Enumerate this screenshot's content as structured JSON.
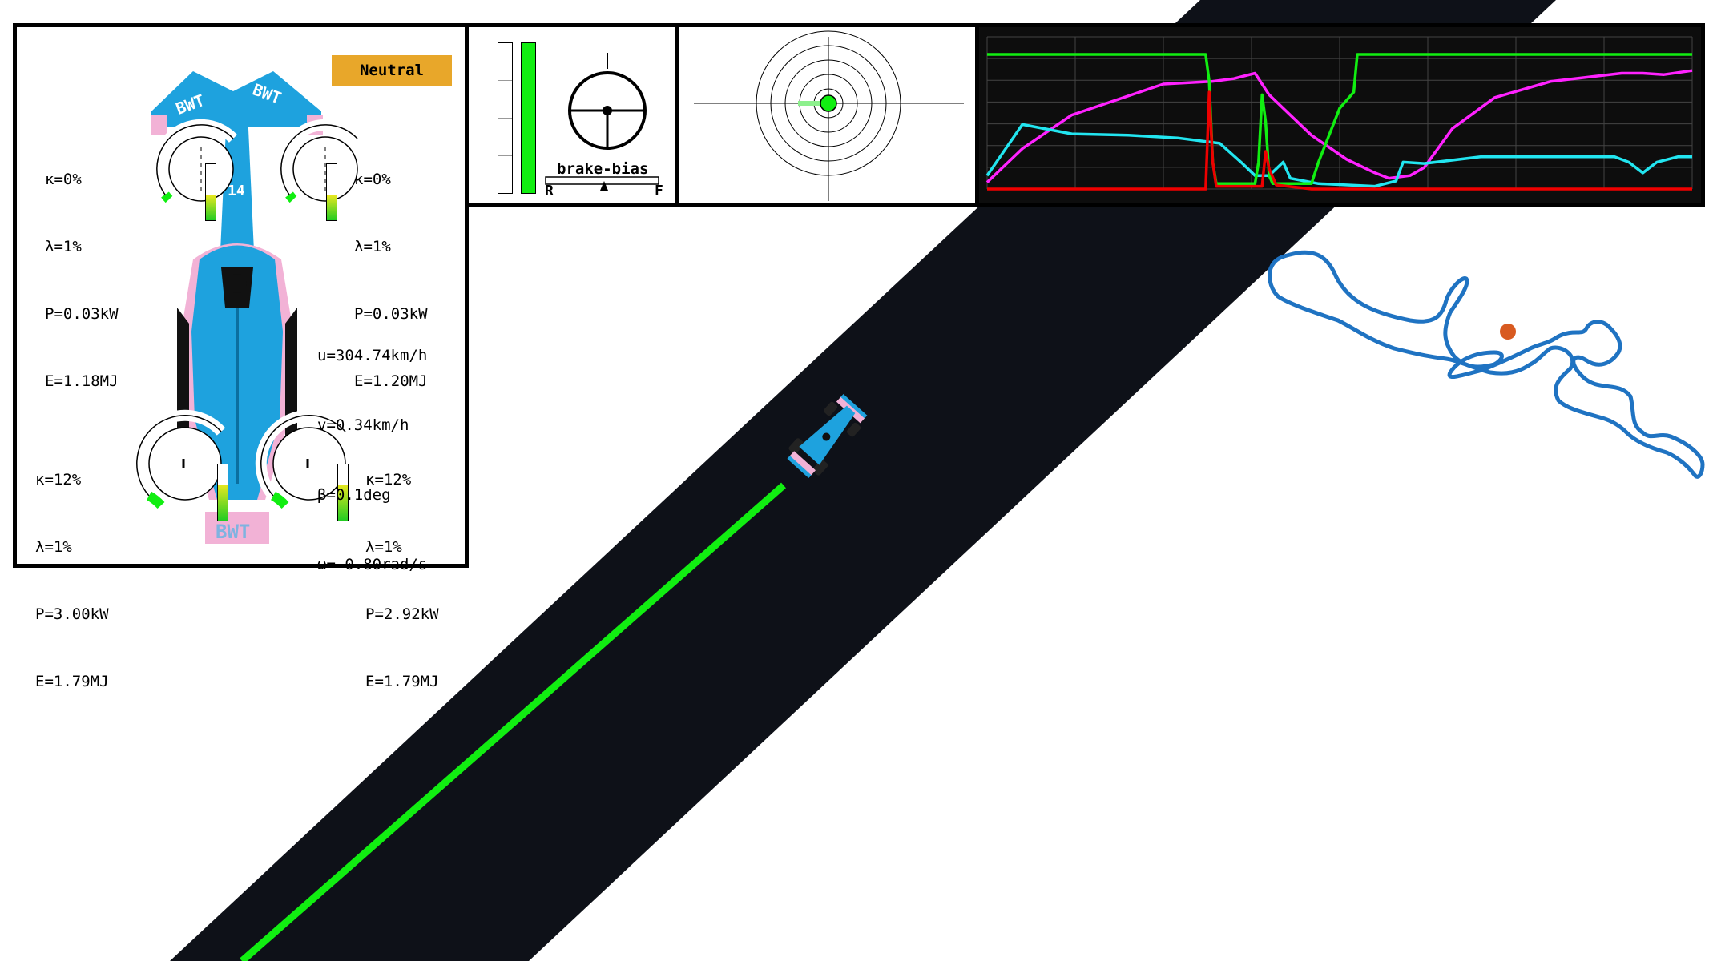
{
  "colors": {
    "road": "#0e1118",
    "trajectory": "#11ee11",
    "telemetry_bg": "#0d0d0d",
    "speed_trace": "#ff22ff",
    "cyan_trace": "#22e5f0",
    "throttle_trace": "#11ee11",
    "brake_trace": "#ee0000",
    "track_outline": "#1f73c2",
    "car_marker": "#d85a20",
    "badge": "#e8a72a",
    "car_blue": "#1ea2de",
    "car_pink": "#f2b2d6"
  },
  "car_panel": {
    "gear_badge": "Neutral",
    "livery_text": "BWT",
    "car_number": "14",
    "wheels": {
      "front_left": {
        "kappa": "κ=0%",
        "lambda": "λ=1%",
        "power": "P=0.03kW",
        "energy": "E=1.18MJ",
        "energy_level": 0.45
      },
      "front_right": {
        "kappa": "κ=0%",
        "lambda": "λ=1%",
        "power": "P=0.03kW",
        "energy": "E=1.20MJ",
        "energy_level": 0.45
      },
      "rear_left": {
        "kappa": "κ=12%",
        "lambda": "λ=1%",
        "power": "P=3.00kW",
        "energy": "E=1.79MJ",
        "energy_level": 0.65
      },
      "rear_right": {
        "kappa": "κ=12%",
        "lambda": "λ=1%",
        "power": "P=2.92kW",
        "energy": "E=1.79MJ",
        "energy_level": 0.65
      }
    },
    "vehicle_state": {
      "u": "u=304.74km/h",
      "v": "v=0.34km/h",
      "beta": "β=0.1deg",
      "omega": "ω=-0.80rad/s"
    }
  },
  "controls_panel": {
    "brake_level": 0.0,
    "throttle_level": 1.0,
    "brake_bias_label": "brake-bias",
    "bias_rear": "R",
    "bias_front": "F"
  },
  "gg_panel": {
    "ring_count": 5
  },
  "telemetry": {
    "series": [
      {
        "key": "speed",
        "color": "#ff22ff",
        "points": [
          [
            0,
            0.05
          ],
          [
            0.05,
            0.3
          ],
          [
            0.12,
            0.55
          ],
          [
            0.25,
            0.78
          ],
          [
            0.32,
            0.8
          ],
          [
            0.35,
            0.82
          ],
          [
            0.38,
            0.86
          ],
          [
            0.4,
            0.7
          ],
          [
            0.46,
            0.4
          ],
          [
            0.51,
            0.22
          ],
          [
            0.55,
            0.12
          ],
          [
            0.57,
            0.08
          ],
          [
            0.6,
            0.1
          ],
          [
            0.62,
            0.16
          ],
          [
            0.66,
            0.45
          ],
          [
            0.72,
            0.68
          ],
          [
            0.8,
            0.8
          ],
          [
            0.9,
            0.86
          ],
          [
            0.93,
            0.86
          ],
          [
            0.96,
            0.85
          ],
          [
            1.0,
            0.88
          ]
        ]
      },
      {
        "key": "cyan",
        "color": "#22e5f0",
        "points": [
          [
            0,
            0.1
          ],
          [
            0.05,
            0.48
          ],
          [
            0.12,
            0.41
          ],
          [
            0.2,
            0.4
          ],
          [
            0.27,
            0.38
          ],
          [
            0.33,
            0.34
          ],
          [
            0.36,
            0.2
          ],
          [
            0.38,
            0.1
          ],
          [
            0.4,
            0.1
          ],
          [
            0.42,
            0.2
          ],
          [
            0.43,
            0.08
          ],
          [
            0.47,
            0.04
          ],
          [
            0.55,
            0.02
          ],
          [
            0.58,
            0.06
          ],
          [
            0.59,
            0.2
          ],
          [
            0.62,
            0.19
          ],
          [
            0.7,
            0.24
          ],
          [
            0.8,
            0.24
          ],
          [
            0.89,
            0.24
          ],
          [
            0.91,
            0.2
          ],
          [
            0.93,
            0.12
          ],
          [
            0.95,
            0.2
          ],
          [
            0.98,
            0.24
          ],
          [
            1.0,
            0.24
          ]
        ]
      },
      {
        "key": "throttle",
        "color": "#11ee11",
        "points": [
          [
            0,
            1.0
          ],
          [
            0.31,
            1.0
          ],
          [
            0.315,
            0.8
          ],
          [
            0.32,
            0.2
          ],
          [
            0.325,
            0.04
          ],
          [
            0.38,
            0.04
          ],
          [
            0.385,
            0.2
          ],
          [
            0.39,
            0.7
          ],
          [
            0.395,
            0.5
          ],
          [
            0.4,
            0.1
          ],
          [
            0.405,
            0.04
          ],
          [
            0.46,
            0.04
          ],
          [
            0.47,
            0.2
          ],
          [
            0.5,
            0.6
          ],
          [
            0.52,
            0.72
          ],
          [
            0.525,
            1.0
          ],
          [
            1.0,
            1.0
          ]
        ]
      },
      {
        "key": "brake",
        "color": "#ee0000",
        "points": [
          [
            0,
            0
          ],
          [
            0.31,
            0
          ],
          [
            0.315,
            0.72
          ],
          [
            0.32,
            0.2
          ],
          [
            0.325,
            0.02
          ],
          [
            0.39,
            0.02
          ],
          [
            0.395,
            0.28
          ],
          [
            0.4,
            0.15
          ],
          [
            0.41,
            0.03
          ],
          [
            0.46,
            0
          ],
          [
            1.0,
            0
          ]
        ]
      }
    ]
  }
}
